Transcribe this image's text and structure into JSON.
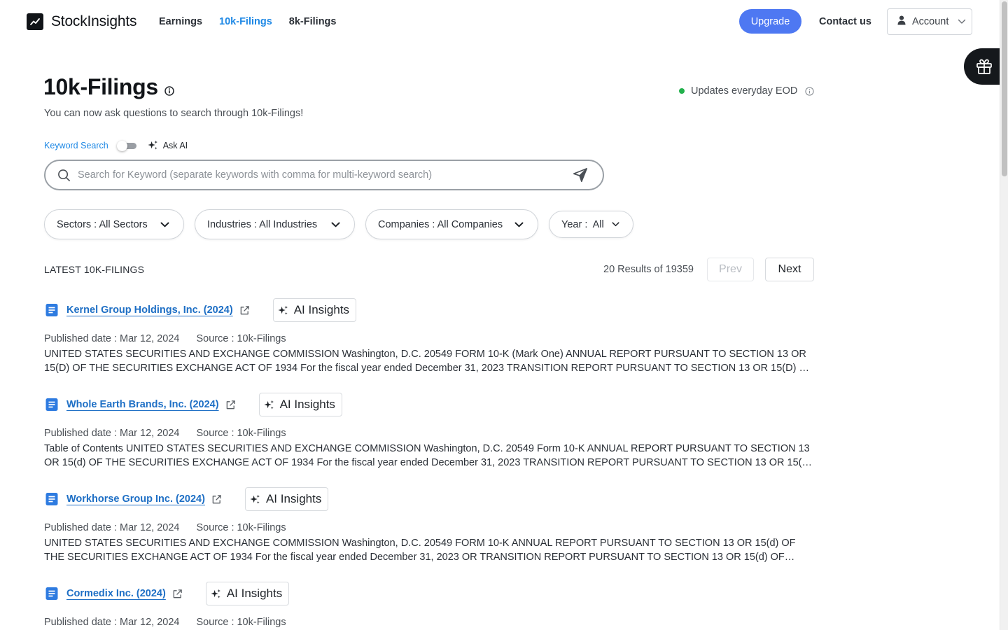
{
  "brand": {
    "name": "StockInsights"
  },
  "nav": {
    "links": [
      {
        "label": "Earnings",
        "active": false
      },
      {
        "label": "10k-Filings",
        "active": true
      },
      {
        "label": "8k-Filings",
        "active": false
      }
    ],
    "upgrade_label": "Upgrade",
    "contact_label": "Contact us",
    "account_label": "Account"
  },
  "header": {
    "title": "10k-Filings",
    "subtitle": "You can now ask questions to search through 10k-Filings!",
    "update_status": "Updates everyday EOD"
  },
  "search": {
    "mode_keyword": "Keyword Search",
    "mode_ai": "Ask AI",
    "placeholder": "Search for Keyword (separate keywords with comma for multi-keyword search)",
    "value": ""
  },
  "filters": {
    "sectors": "Sectors : All Sectors",
    "industries": "Industries : All Industries",
    "companies": "Companies : All Companies",
    "year": "Year :  All"
  },
  "results": {
    "label": "LATEST 10K-FILINGS",
    "count": "20 Results of 19359",
    "prev_label": "Prev",
    "next_label": "Next"
  },
  "ai_insights_label": "AI Insights",
  "filings": [
    {
      "title": "Kernel Group Holdings, Inc. (2024)",
      "published": "Published date : Mar 12, 2024",
      "source": "Source : 10k-Filings",
      "excerpt": "UNITED STATES SECURITIES AND EXCHANGE COMMISSION Washington, D.C. 20549 FORM 10-K (Mark One) ANNUAL REPORT PURSUANT TO SECTION 13 OR 15(D) OF THE SECURITIES EXCHANGE ACT OF 1934 For the fiscal year ended December 31, 2023 TRANSITION REPORT PURSUANT TO SECTION 13 OR 15(D) OF THE..."
    },
    {
      "title": "Whole Earth Brands, Inc. (2024)",
      "published": "Published date : Mar 12, 2024",
      "source": "Source : 10k-Filings",
      "excerpt": "Table of Contents UNITED STATES SECURITIES AND EXCHANGE COMMISSION Washington, D.C. 20549 Form 10-K ANNUAL REPORT PURSUANT TO SECTION 13 OR 15(d) OF THE SECURITIES EXCHANGE ACT OF 1934 For the fiscal year ended December 31, 2023 TRANSITION REPORT PURSUANT TO SECTION 13 OR 15(d) OF T..."
    },
    {
      "title": "Workhorse Group Inc. (2024)",
      "published": "Published date : Mar 12, 2024",
      "source": "Source : 10k-Filings",
      "excerpt": "UNITED STATES SECURITIES AND EXCHANGE COMMISSION Washington, D.C. 20549 FORM 10-K ANNUAL REPORT PURSUANT TO SECTION 13 OR 15(d) OF THE SECURITIES EXCHANGE ACT OF 1934 For the fiscal year ended December 31, 2023 OR TRANSITION REPORT PURSUANT TO SECTION 13 OR 15(d) OF THE..."
    },
    {
      "title": "Cormedix Inc. (2024)",
      "published": "Published date : Mar 12, 2024",
      "source": "Source : 10k-Filings",
      "excerpt": ""
    }
  ],
  "colors": {
    "accent": "#1e88e5",
    "upgrade": "#4e78f2",
    "status_green": "#22b14c",
    "link": "#1e6fc5"
  },
  "icons": {
    "logo": "trend-line-icon",
    "title_info": "info-icon",
    "status_info": "info-icon",
    "account": "user-icon",
    "account_chevron": "chevron-down-icon",
    "gift": "gift-icon",
    "ask_ai": "sparkle-icon",
    "search": "search-icon",
    "send": "send-icon",
    "filter_chevron": "chevron-down-icon",
    "doc": "document-icon",
    "external": "external-link-icon",
    "ai_insights": "sparkle-icon"
  }
}
